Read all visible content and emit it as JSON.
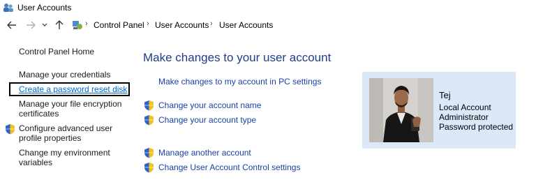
{
  "window": {
    "title": "User Accounts"
  },
  "address_bar": {
    "crumbs": [
      "Control Panel",
      "User Accounts",
      "User Accounts"
    ]
  },
  "left_pane": {
    "home": "Control Panel Home",
    "manage_credentials": "Manage your credentials",
    "reset_disk": "Create a password reset disk",
    "encryption_line1": "Manage your file encryption",
    "encryption_line2": "certificates",
    "advanced_line1": "Configure advanced user",
    "advanced_line2": "profile properties",
    "env_line1": "Change my environment",
    "env_line2": "variables"
  },
  "main": {
    "heading": "Make changes to your user account",
    "pc_settings": "Make changes to my account in PC settings",
    "change_name": "Change your account name",
    "change_type": "Change your account type",
    "manage_another": "Manage another account",
    "uac_settings": "Change User Account Control settings"
  },
  "user": {
    "name": "Tej",
    "account_type": "Local Account",
    "role": "Administrator",
    "password_status": "Password protected"
  },
  "colors": {
    "heading": "#1e3c8a",
    "link": "#1a3fa6",
    "panel": "#dbe8f8",
    "highlight": "#000000"
  },
  "icons": [
    "users-icon",
    "back-arrow-icon",
    "forward-arrow-icon",
    "recent-dropdown-icon",
    "up-arrow-icon",
    "control-panel-icon",
    "uac-shield-icon"
  ]
}
